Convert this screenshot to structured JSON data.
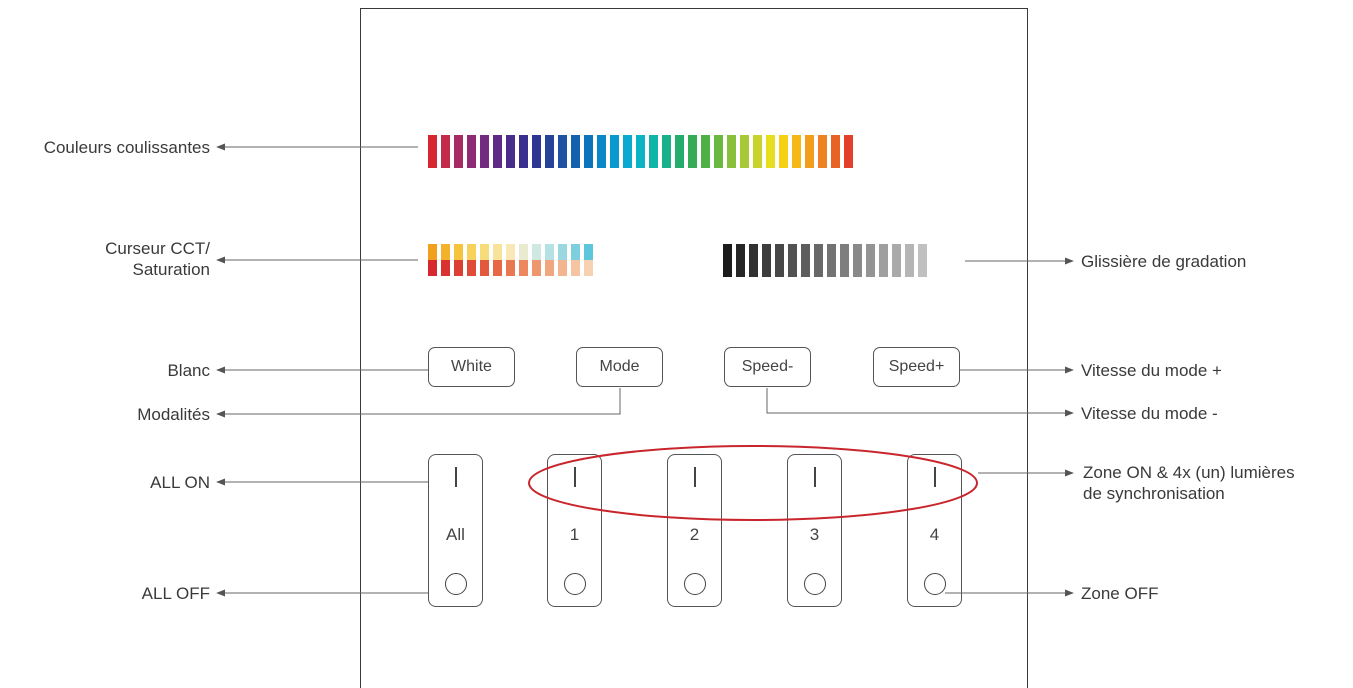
{
  "labels_left": {
    "couleurs": "Couleurs coulissantes",
    "cct_line1": "Curseur CCT/",
    "cct_line2": "Saturation",
    "blanc": "Blanc",
    "modalites": "Modalités",
    "all_on": "ALL ON",
    "all_off": "ALL OFF"
  },
  "labels_right": {
    "gradation": "Glissière de gradation",
    "vitesse_plus": "Vitesse du mode +",
    "vitesse_moins": "Vitesse du mode -",
    "zone_on_line1": "Zone ON & 4x (un) lumières",
    "zone_on_line2": "de synchronisation",
    "zone_off": "Zone OFF"
  },
  "buttons": {
    "white": "White",
    "mode": "Mode",
    "speed_minus": "Speed-",
    "speed_plus": "Speed+"
  },
  "zones": [
    {
      "label": "All"
    },
    {
      "label": "1"
    },
    {
      "label": "2"
    },
    {
      "label": "3"
    },
    {
      "label": "4"
    }
  ],
  "colors": {
    "highlight_ellipse": "#c8262c",
    "rainbow": [
      "#d7262e",
      "#c42a4a",
      "#a82a62",
      "#8f2a74",
      "#742a80",
      "#5e2a86",
      "#4a2c8a",
      "#3a2f8e",
      "#2d3692",
      "#274399",
      "#1f52a3",
      "#1462ae",
      "#0c74bb",
      "#0a87c8",
      "#0a99cf",
      "#0aa9cf",
      "#0bb4c2",
      "#10b5a7",
      "#19b08a",
      "#24ac6c",
      "#34ab55",
      "#4fb046",
      "#6ab83f",
      "#88c03b",
      "#a7c935",
      "#c8d42c",
      "#e6df1d",
      "#f5d112",
      "#f6b816",
      "#f39d1d",
      "#ee8121",
      "#e96224",
      "#e2402a"
    ],
    "cct_top": [
      "#f0a01c",
      "#f3b22a",
      "#f5c43c",
      "#f6d25a",
      "#f7dc7a",
      "#f8e39a",
      "#f9e8b6",
      "#e8ebd0",
      "#cfe9e2",
      "#b4e1e3",
      "#9ad8e1",
      "#7dcfde",
      "#5ec6dc"
    ],
    "cct_bottom": [
      "#d7262e",
      "#da3231",
      "#dd3e34",
      "#e04b38",
      "#e3593e",
      "#e66846",
      "#e97752",
      "#ec875f",
      "#ee976e",
      "#f0a67e",
      "#f3b58f",
      "#f5c4a0",
      "#f7d2b2"
    ],
    "gradation": [
      "#1b1b1b",
      "#262626",
      "#313131",
      "#3c3c3c",
      "#474747",
      "#525252",
      "#5d5d5d",
      "#686868",
      "#737373",
      "#7e7e7e",
      "#898989",
      "#949494",
      "#9f9f9f",
      "#aaaaaa",
      "#b5b5b5",
      "#c0c0c0"
    ]
  }
}
